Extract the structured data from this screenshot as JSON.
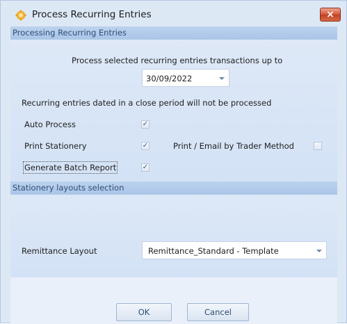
{
  "window": {
    "title": "Process Recurring Entries",
    "icon": "gear-icon",
    "close_glyph": "×"
  },
  "processing_panel": {
    "header": "Processing Recurring Entries",
    "prompt": "Process selected recurring entries transactions  up to",
    "date_value": "30/09/2022",
    "warning": "Recurring entries dated in a close period will not be processed",
    "options": {
      "auto_process": {
        "label": "Auto Process",
        "checked": true
      },
      "print_stationery": {
        "label": "Print Stationery",
        "checked": true
      },
      "print_email_trader": {
        "label": "Print / Email by Trader Method",
        "checked": false
      },
      "generate_batch_report": {
        "label": "Generate Batch Report",
        "checked": true
      }
    }
  },
  "stationery_panel": {
    "header": "Stationery layouts selection",
    "remittance_label": "Remittance Layout",
    "remittance_value": "Remittance_Standard - Template"
  },
  "buttons": {
    "ok": "OK",
    "cancel": "Cancel"
  },
  "colors": {
    "window_bg": "#dde8f5",
    "panel_header_bg": "#aac5e8",
    "panel_header_text": "#2e4d73",
    "close_button": "#c1401f"
  }
}
